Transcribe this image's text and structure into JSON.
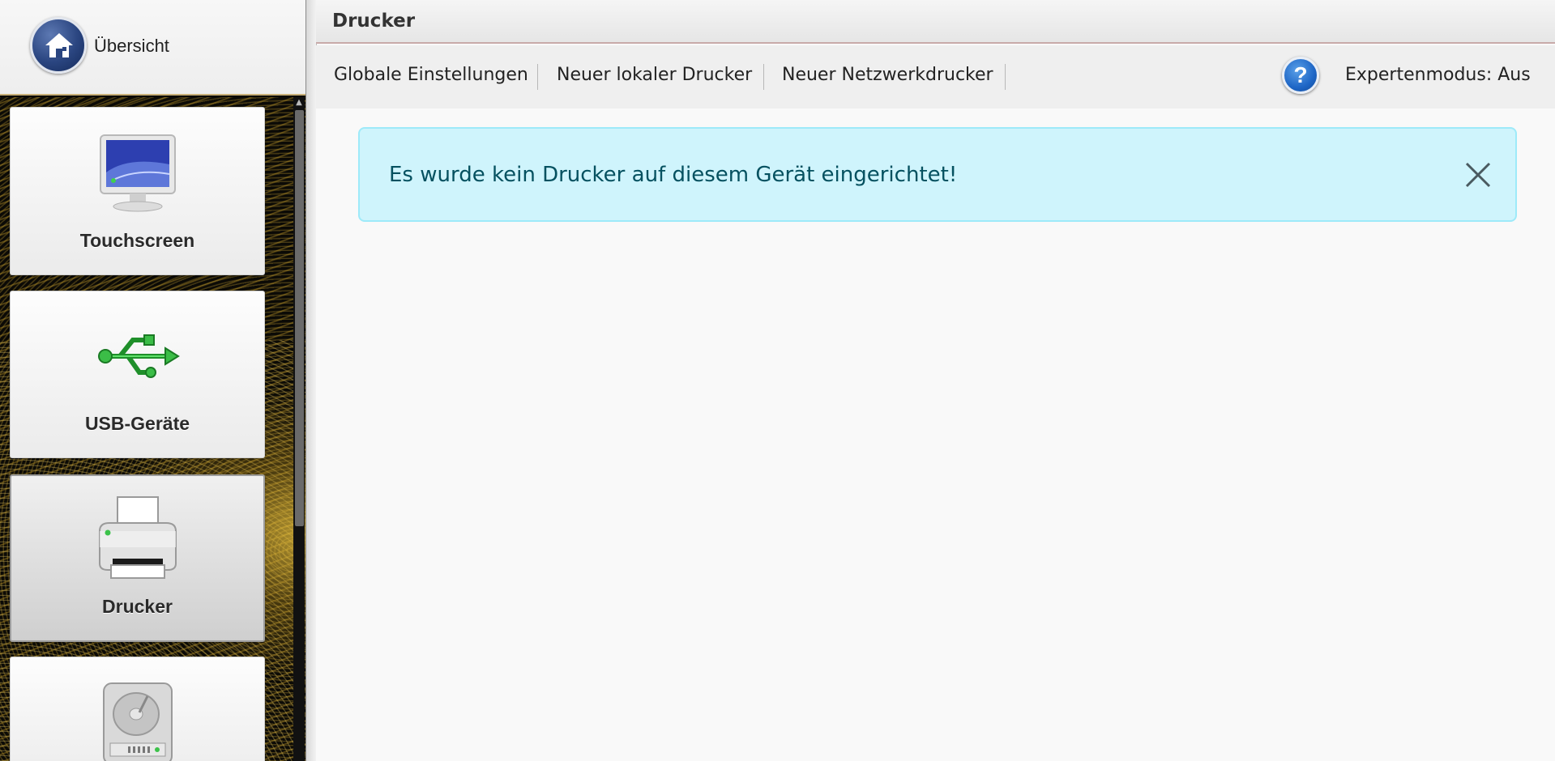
{
  "sidebar": {
    "overview_label": "Übersicht",
    "tiles": [
      {
        "label": "Touchscreen",
        "icon": "monitor-icon"
      },
      {
        "label": "USB-Geräte",
        "icon": "usb-icon"
      },
      {
        "label": "Drucker",
        "icon": "printer-icon",
        "active": true
      },
      {
        "label": "",
        "icon": "hard-drive-icon"
      }
    ]
  },
  "header": {
    "title": "Drucker"
  },
  "toolbar": {
    "global_settings": "Globale Einstellungen",
    "new_local_printer": "Neuer lokaler Drucker",
    "new_network_printer": "Neuer Netzwerkdrucker",
    "help_icon": "question-icon",
    "expert_mode": "Expertenmodus: Aus"
  },
  "alert": {
    "message": "Es wurde kein Drucker auf diesem Gerät eingerichtet!",
    "color_bg": "#cff4fc",
    "color_text": "#055160"
  }
}
